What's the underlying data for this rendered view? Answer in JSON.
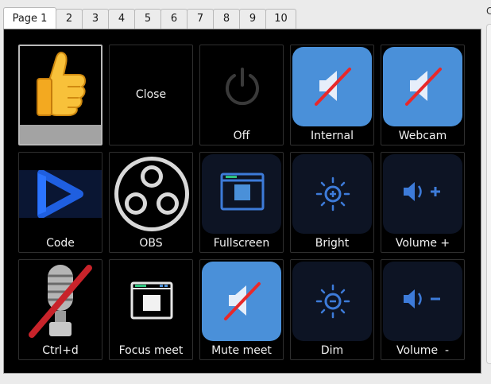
{
  "tabs": [
    "Page 1",
    "2",
    "3",
    "4",
    "5",
    "6",
    "7",
    "8",
    "9",
    "10"
  ],
  "active_tab": "Page 1",
  "right_panel_letter": "C",
  "buttons": {
    "thumb": {
      "label": "",
      "icon": "thumbs-up-emoji"
    },
    "close": {
      "label": "Close"
    },
    "off": {
      "label": "Off",
      "icon": "power-icon"
    },
    "internal": {
      "label": "Internal",
      "icon": "muted-speaker-icon"
    },
    "webcam": {
      "label": "Webcam",
      "icon": "muted-speaker-icon"
    },
    "code": {
      "label": "Code",
      "icon": "vscode-logo"
    },
    "obs": {
      "label": "OBS",
      "icon": "obs-logo"
    },
    "fullscreen": {
      "label": "Fullscreen",
      "icon": "fullscreen-window-icon"
    },
    "bright": {
      "label": "Bright",
      "icon": "brightness-up-icon"
    },
    "volume_up": {
      "label": "Volume +",
      "icon": "volume-up-icon"
    },
    "ctrl_d": {
      "label": "Ctrl+d",
      "icon": "microphone-off-icon"
    },
    "focus_meet": {
      "label": "Focus meet",
      "icon": "window-focus-icon"
    },
    "mute_meet": {
      "label": "Mute meet",
      "icon": "muted-speaker-icon"
    },
    "dim": {
      "label": "Dim",
      "icon": "brightness-down-icon"
    },
    "volume_down": {
      "label": "Volume  -",
      "icon": "volume-down-icon"
    }
  },
  "colors": {
    "accent_blue": "#4a90d9",
    "icon_blue": "#3d7bd9",
    "tile_navy": "#0d1424",
    "mute_slash": "#e8292a"
  }
}
